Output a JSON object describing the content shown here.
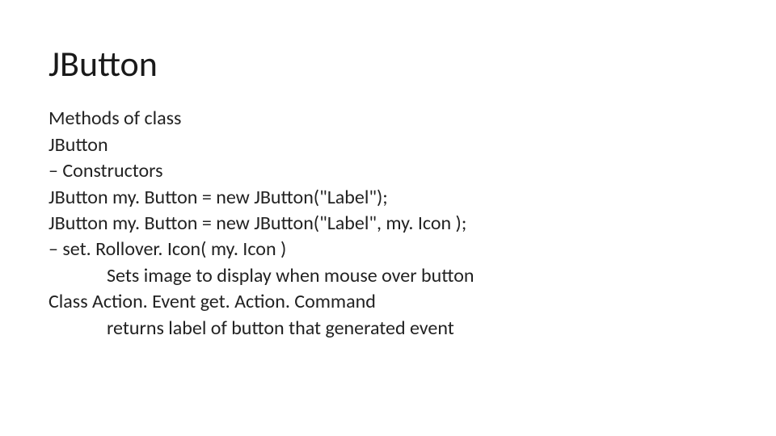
{
  "title": "JButton",
  "lines": [
    "Methods of class",
    "JButton",
    "– Constructors",
    "JButton my. Button = new JButton(\"Label\");",
    "JButton my. Button = new JButton(\"Label\", my. Icon );",
    "– set. Rollover. Icon( my. Icon )"
  ],
  "indent1": "Sets image to display when mouse over button",
  "line_after": "Class Action. Event get. Action. Command",
  "indent2": "returns label of button that generated event"
}
